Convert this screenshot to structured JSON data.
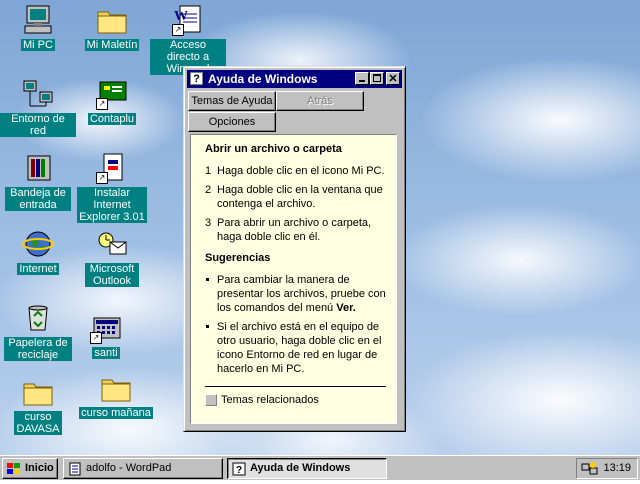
{
  "desktop": {
    "icons": [
      {
        "label": "Mi PC",
        "icon": "computer-icon"
      },
      {
        "label": "Mi Maletín",
        "icon": "briefcase-icon"
      },
      {
        "label": "Acceso directo a Winword",
        "icon": "word-document-icon"
      },
      {
        "label": "Entorno de red",
        "icon": "network-icon"
      },
      {
        "label": "Contaplu",
        "icon": "app-icon"
      },
      {
        "label": "Bandeja de entrada",
        "icon": "inbox-icon"
      },
      {
        "label": "Instalar Internet Explorer 3.01",
        "icon": "installer-icon"
      },
      {
        "label": "Internet",
        "icon": "globe-icon"
      },
      {
        "label": "Microsoft Outlook",
        "icon": "outlook-icon"
      },
      {
        "label": "Papelera de reciclaje",
        "icon": "recycle-bin-icon"
      },
      {
        "label": "santi",
        "icon": "calculator-icon"
      },
      {
        "label": "curso DAVASA",
        "icon": "folder-icon"
      },
      {
        "label": "curso mañana",
        "icon": "folder-icon"
      }
    ]
  },
  "help": {
    "title": "Ayuda de Windows",
    "buttons": {
      "topics": "Temas de Ayuda",
      "back": "Atrás",
      "options": "Opciones"
    },
    "heading": "Abrir un archivo o carpeta",
    "steps": [
      "Haga doble clic en el icono Mi PC.",
      "Haga doble clic en la ventana que contenga el archivo.",
      "Para abrir un archivo o carpeta, haga doble clic en él."
    ],
    "tips_heading": "Sugerencias",
    "tip1": "Para cambiar la manera de presentar los archivos, pruebe con los comandos del menú",
    "tip1_bold": "Ver.",
    "tip2": "Si el archivo está en el equipo de otro usuario, haga doble clic en el icono Entorno de red en lugar de hacerlo en Mi PC.",
    "related": "Temas relacionados"
  },
  "taskbar": {
    "start": "Inicio",
    "tasks": [
      "adolfo - WordPad",
      "Ayuda de Windows"
    ],
    "clock": "13:19"
  },
  "colors": {
    "titlebar": "#000080",
    "desktop_label_bg": "#008080",
    "help_bg": "#ffffe1",
    "chrome": "#c0c0c0"
  }
}
